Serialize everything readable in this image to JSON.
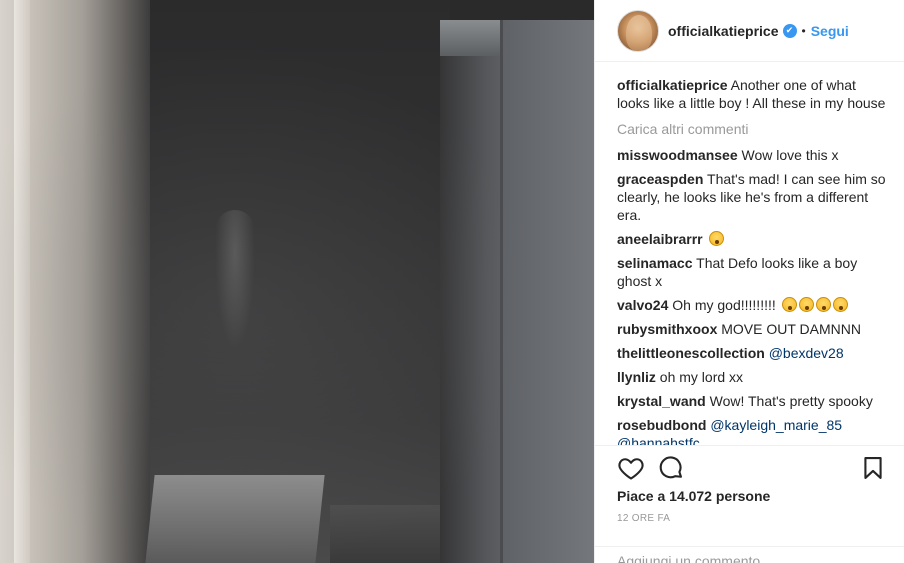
{
  "post": {
    "username": "officialkatieprice",
    "verified_badge": "✔",
    "separator": "•",
    "follow_label": "Segui",
    "caption_user": "officialkatieprice",
    "caption_text": "Another one of what looks like a little boy ! All these in my house"
  },
  "load_more": "Carica altri commenti",
  "comments": [
    {
      "user": "misswoodmansee",
      "text": "Wow love this x"
    },
    {
      "user": "graceaspden",
      "text": "That's mad! I can see him so clearly, he looks like he's from a different era."
    },
    {
      "user": "aneelaibrarrr",
      "text": ""
    },
    {
      "user": "selinamacc",
      "text": "That Defo looks like a boy ghost x"
    },
    {
      "user": "valvo24",
      "text": "Oh my god!!!!!!!!!"
    },
    {
      "user": "rubysmithxoox",
      "text": "MOVE OUT DAMNNN"
    },
    {
      "user": "thelittleonescollection",
      "mention": "@bexdev28"
    },
    {
      "user": "llynliz",
      "text": "oh my lord xx"
    },
    {
      "user": "krystal_wand",
      "text": "Wow! That's pretty spooky"
    },
    {
      "user": "rosebudbond",
      "mention": "@kayleigh_marie_85",
      "mention2": "@hannahstfc"
    }
  ],
  "icons": {
    "like": "heart-icon",
    "comment": "comment-bubble-icon",
    "save": "bookmark-icon",
    "more": "more-options-icon"
  },
  "likes_text": "Piace a 14.072 persone",
  "timestamp": "12 ORE FA",
  "add_comment_placeholder": "Aggiungi un commento...",
  "more_symbol": "...",
  "colors": {
    "accent": "#3897f0",
    "mention": "#003569",
    "muted": "#999999"
  }
}
